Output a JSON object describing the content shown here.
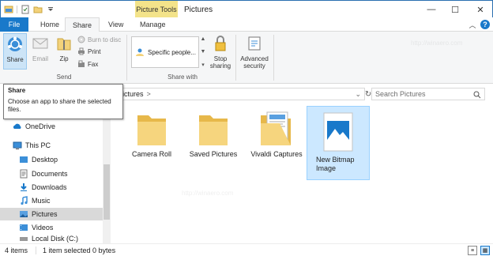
{
  "window": {
    "title": "Pictures",
    "context_tab": "Picture Tools",
    "min_glyph": "—",
    "max_glyph": "☐",
    "close_glyph": "✕"
  },
  "tabs": {
    "file": "File",
    "home": "Home",
    "share": "Share",
    "view": "View",
    "manage": "Manage"
  },
  "ribbon": {
    "send": {
      "share": "Share",
      "email": "Email",
      "zip": "Zip",
      "burn": "Burn to disc",
      "print": "Print",
      "fax": "Fax",
      "group_label": "Send"
    },
    "share_with": {
      "people": "Specific people...",
      "stop_line1": "Stop",
      "stop_line2": "sharing",
      "group_label": "Share with"
    },
    "advanced": {
      "line1": "Advanced",
      "line2": "security"
    }
  },
  "address": {
    "path_tail": "ictures",
    "separator": ">",
    "dropdown": "⌄",
    "refresh": "↻"
  },
  "search": {
    "placeholder": "Search Pictures"
  },
  "tooltip": {
    "title": "Share",
    "body": "Choose an app to share the selected files."
  },
  "nav": {
    "items": [
      {
        "label": "OneDrive",
        "icon": "onedrive-icon"
      },
      {
        "label": "This PC",
        "icon": "pc-icon"
      },
      {
        "label": "Desktop",
        "icon": "desktop-icon"
      },
      {
        "label": "Documents",
        "icon": "documents-icon"
      },
      {
        "label": "Downloads",
        "icon": "downloads-icon"
      },
      {
        "label": "Music",
        "icon": "music-icon"
      },
      {
        "label": "Pictures",
        "icon": "pictures-icon",
        "selected": true
      },
      {
        "label": "Videos",
        "icon": "videos-icon"
      },
      {
        "label": "Local Disk (C:)",
        "icon": "drive-icon"
      }
    ]
  },
  "files": [
    {
      "name": "Camera Roll",
      "type": "folder"
    },
    {
      "name": "Saved Pictures",
      "type": "folder"
    },
    {
      "name": "Vivaldi Captures",
      "type": "folder-with-images"
    },
    {
      "name": "New Bitmap Image",
      "type": "bitmap",
      "selected": true
    }
  ],
  "status": {
    "count": "4 items",
    "selection": "1 item selected  0 bytes"
  },
  "watermark": "http://winaero.com",
  "colors": {
    "accent": "#1979ca",
    "picture_tools": "#f3e38a",
    "selection": "#cce8ff",
    "folder": "#f3d27a"
  }
}
